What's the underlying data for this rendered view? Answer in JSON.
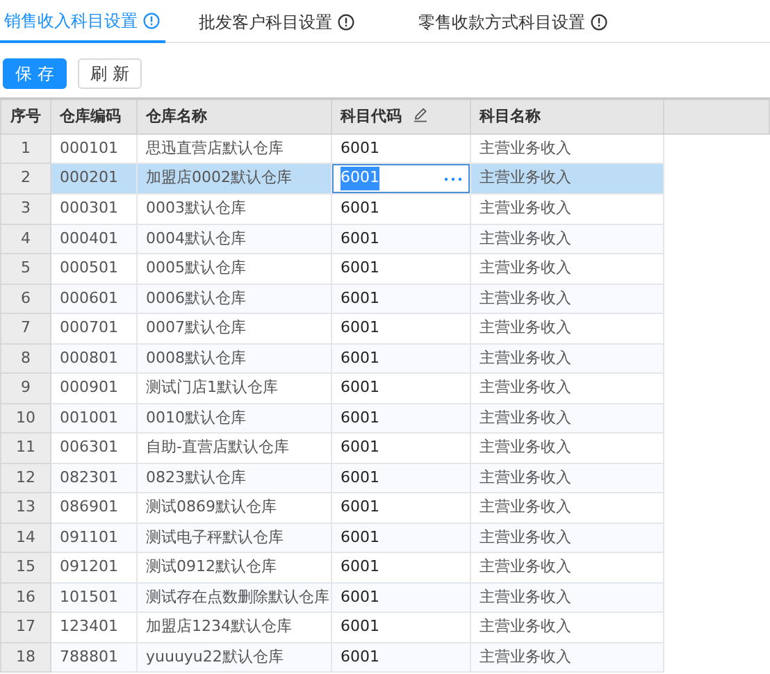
{
  "tabs": [
    {
      "label": "销售收入科目设置",
      "selected": true
    },
    {
      "label": "批发客户科目设置",
      "selected": false
    },
    {
      "label": "零售收款方式科目设置",
      "selected": false
    }
  ],
  "buttons": [
    {
      "label": "保 存",
      "kind": "primary"
    },
    {
      "label": "刷 新",
      "kind": "default"
    }
  ],
  "table": {
    "columns": [
      {
        "label": "序号",
        "editable": false
      },
      {
        "label": "仓库编码",
        "editable": false
      },
      {
        "label": "仓库名称",
        "editable": false
      },
      {
        "label": "科目代码",
        "editable": true
      },
      {
        "label": "科目名称",
        "editable": false
      }
    ],
    "rows": [
      {
        "no": "1",
        "code": "000101",
        "name": "思迅直营店默认仓库",
        "account_code": "6001",
        "account_name": "主营业务收入",
        "selected": false,
        "editing": false
      },
      {
        "no": "2",
        "code": "000201",
        "name": "加盟店0002默认仓库",
        "account_code": "6001",
        "account_name": "主营业务收入",
        "selected": true,
        "editing": true
      },
      {
        "no": "3",
        "code": "000301",
        "name": "0003默认仓库",
        "account_code": "6001",
        "account_name": "主营业务收入",
        "selected": false,
        "editing": false
      },
      {
        "no": "4",
        "code": "000401",
        "name": "0004默认仓库",
        "account_code": "6001",
        "account_name": "主营业务收入",
        "selected": false,
        "editing": false
      },
      {
        "no": "5",
        "code": "000501",
        "name": "0005默认仓库",
        "account_code": "6001",
        "account_name": "主营业务收入",
        "selected": false,
        "editing": false
      },
      {
        "no": "6",
        "code": "000601",
        "name": "0006默认仓库",
        "account_code": "6001",
        "account_name": "主营业务收入",
        "selected": false,
        "editing": false
      },
      {
        "no": "7",
        "code": "000701",
        "name": "0007默认仓库",
        "account_code": "6001",
        "account_name": "主营业务收入",
        "selected": false,
        "editing": false
      },
      {
        "no": "8",
        "code": "000801",
        "name": "0008默认仓库",
        "account_code": "6001",
        "account_name": "主营业务收入",
        "selected": false,
        "editing": false
      },
      {
        "no": "9",
        "code": "000901",
        "name": "测试门店1默认仓库",
        "account_code": "6001",
        "account_name": "主营业务收入",
        "selected": false,
        "editing": false
      },
      {
        "no": "10",
        "code": "001001",
        "name": "0010默认仓库",
        "account_code": "6001",
        "account_name": "主营业务收入",
        "selected": false,
        "editing": false
      },
      {
        "no": "11",
        "code": "006301",
        "name": "自助-直营店默认仓库",
        "account_code": "6001",
        "account_name": "主营业务收入",
        "selected": false,
        "editing": false
      },
      {
        "no": "12",
        "code": "082301",
        "name": "0823默认仓库",
        "account_code": "6001",
        "account_name": "主营业务收入",
        "selected": false,
        "editing": false
      },
      {
        "no": "13",
        "code": "086901",
        "name": "测试0869默认仓库",
        "account_code": "6001",
        "account_name": "主营业务收入",
        "selected": false,
        "editing": false
      },
      {
        "no": "14",
        "code": "091101",
        "name": "测试电子秤默认仓库",
        "account_code": "6001",
        "account_name": "主营业务收入",
        "selected": false,
        "editing": false
      },
      {
        "no": "15",
        "code": "091201",
        "name": "测试0912默认仓库",
        "account_code": "6001",
        "account_name": "主营业务收入",
        "selected": false,
        "editing": false
      },
      {
        "no": "16",
        "code": "101501",
        "name": "测试存在点数删除默认仓库",
        "account_code": "6001",
        "account_name": "主营业务收入",
        "selected": false,
        "editing": false
      },
      {
        "no": "17",
        "code": "123401",
        "name": "加盟店1234默认仓库",
        "account_code": "6001",
        "account_name": "主营业务收入",
        "selected": false,
        "editing": false
      },
      {
        "no": "18",
        "code": "788801",
        "name": "yuuuyu22默认仓库",
        "account_code": "6001",
        "account_name": "主营业务收入",
        "selected": false,
        "editing": false
      }
    ]
  }
}
